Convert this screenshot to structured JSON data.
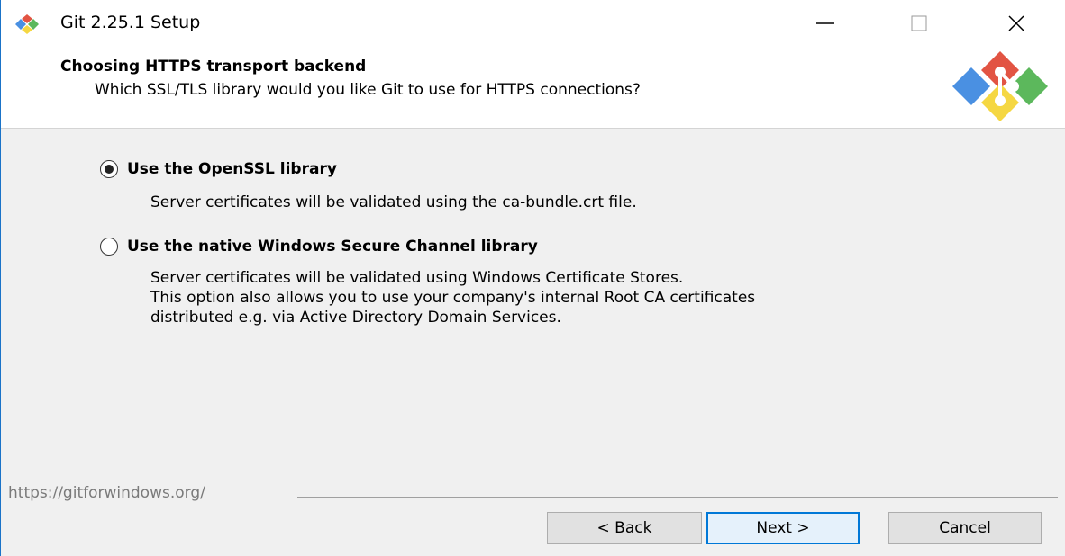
{
  "window": {
    "title": "Git 2.25.1 Setup"
  },
  "header": {
    "title": "Choosing HTTPS transport backend",
    "subtitle": "Which SSL/TLS library would you like Git to use for HTTPS connections?"
  },
  "options": [
    {
      "label": "Use the OpenSSL library",
      "selected": true,
      "description": "Server certificates will be validated using the ca-bundle.crt file."
    },
    {
      "label": "Use the native Windows Secure Channel library",
      "selected": false,
      "description_lines": [
        "Server certificates will be validated using Windows Certificate Stores.",
        "This option also allows you to use your company's internal Root CA certificates",
        "distributed e.g. via Active Directory Domain Services."
      ]
    }
  ],
  "footer": {
    "link": "https://gitforwindows.org/",
    "back_label": "< Back",
    "next_label": "Next >",
    "cancel_label": "Cancel"
  },
  "colors": {
    "accent": "#0078d7",
    "logo_red": "#e25443",
    "logo_green": "#5cb85c",
    "logo_blue": "#4a90e2",
    "logo_yellow": "#f5d742"
  },
  "icons": {
    "app": "git-logo-icon",
    "minimize": "minimize-icon",
    "maximize": "maximize-icon",
    "close": "close-icon"
  }
}
